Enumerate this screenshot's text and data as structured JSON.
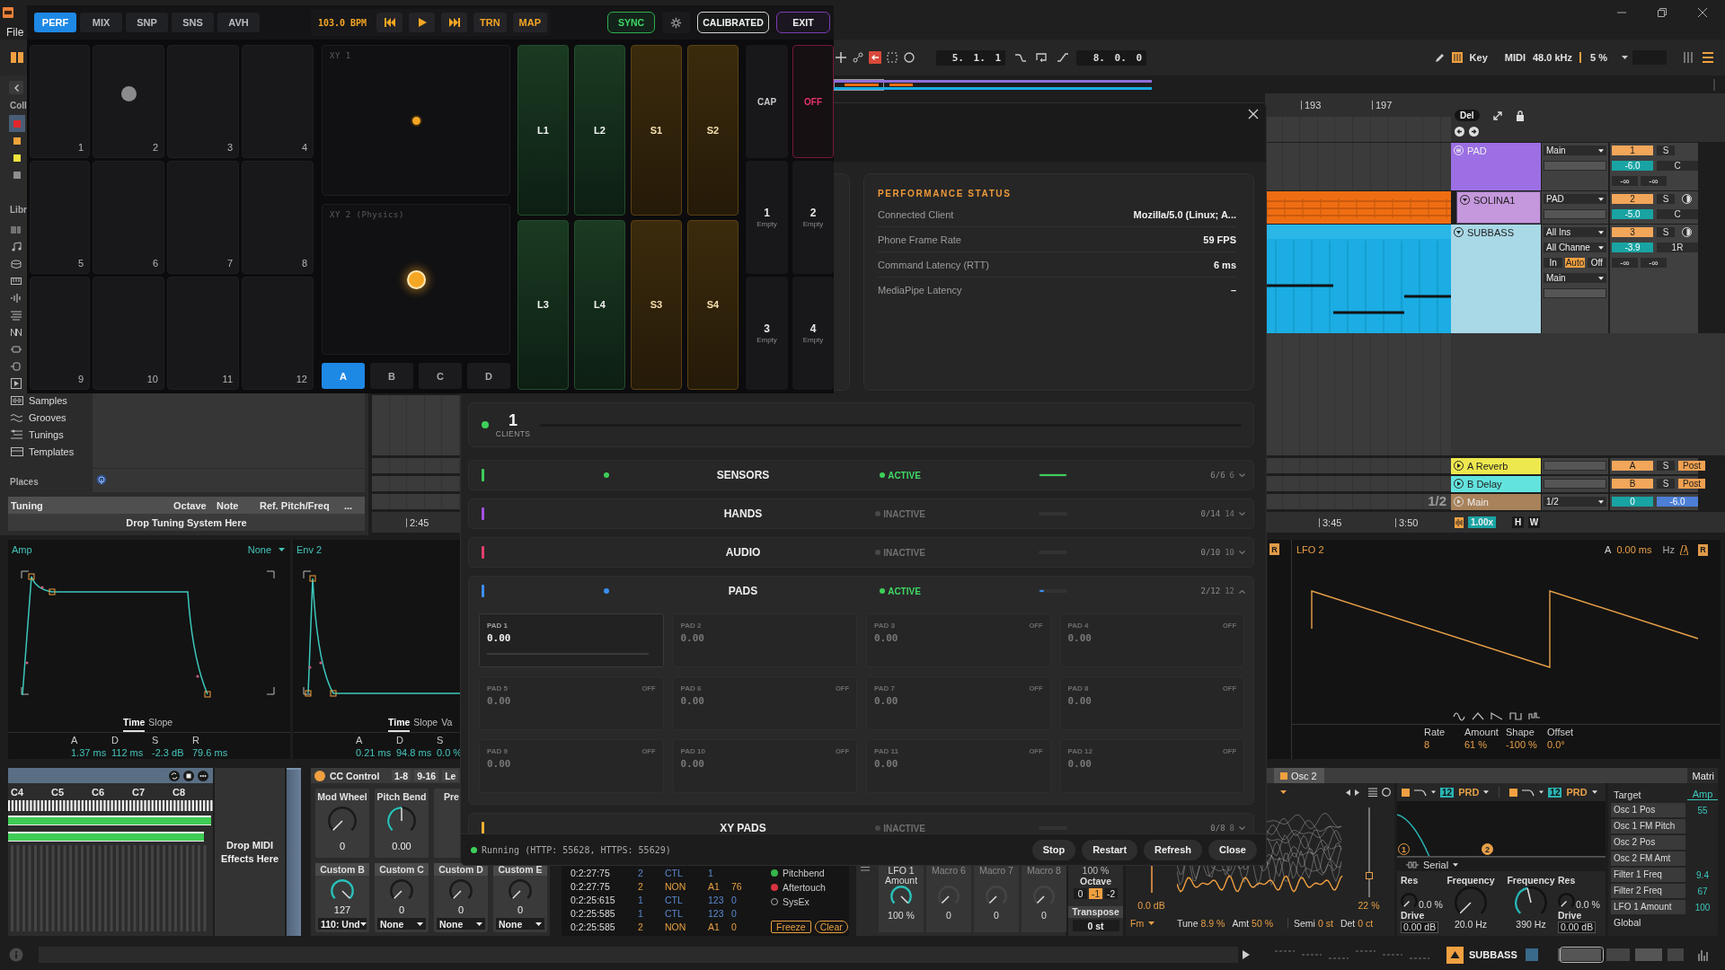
{
  "perf_panel": {
    "tabs": [
      {
        "label": "PERF",
        "selected": true
      },
      {
        "label": "MIX",
        "selected": false
      },
      {
        "label": "SNP",
        "selected": false
      },
      {
        "label": "SNS",
        "selected": false
      },
      {
        "label": "AVH",
        "selected": false
      }
    ],
    "tempo": "103.0 BPM",
    "mode_buttons": [
      "TRN",
      "MAP"
    ],
    "status_buttons": [
      {
        "kind": "sync",
        "label": "SYNC"
      },
      {
        "kind": "settings"
      },
      {
        "kind": "calibrated",
        "label": "CALIBRATED"
      },
      {
        "kind": "exit",
        "label": "EXIT"
      }
    ],
    "pads": [
      {
        "label": "1",
        "pressed": false
      },
      {
        "label": "2",
        "pressed": true
      },
      {
        "label": "3",
        "pressed": false
      },
      {
        "label": "4",
        "pressed": false
      },
      {
        "label": "5",
        "pressed": false
      },
      {
        "label": "6",
        "pressed": false
      },
      {
        "label": "7",
        "pressed": false
      },
      {
        "label": "8",
        "pressed": false
      },
      {
        "label": "9",
        "pressed": false
      },
      {
        "label": "10",
        "pressed": false
      },
      {
        "label": "11",
        "pressed": false
      },
      {
        "label": "12",
        "pressed": false
      }
    ],
    "xy_pads": [
      {
        "title": "XY 1",
        "kind": "plain"
      },
      {
        "title": "XY 2 (Physics)",
        "kind": "physics"
      }
    ],
    "banks": [
      {
        "label": "A",
        "selected": true
      },
      {
        "label": "B",
        "selected": false
      },
      {
        "label": "C",
        "selected": false
      },
      {
        "label": "D",
        "selected": false
      }
    ],
    "loops": [
      {
        "label": "L1",
        "kind": "loop"
      },
      {
        "label": "L2",
        "kind": "loop"
      },
      {
        "label": "S1",
        "kind": "sample"
      },
      {
        "label": "S2",
        "kind": "sample"
      },
      {
        "label": "L3",
        "kind": "loop"
      },
      {
        "label": "L4",
        "kind": "loop"
      },
      {
        "label": "S3",
        "kind": "sample"
      },
      {
        "label": "S4",
        "kind": "sample"
      }
    ],
    "capture": "CAP",
    "power": {
      "label": "OFF",
      "on": false
    },
    "slots": [
      {
        "number": "1",
        "status": "Empty"
      },
      {
        "number": "2",
        "status": "Empty"
      },
      {
        "number": "3",
        "status": "Empty"
      },
      {
        "number": "4",
        "status": "Empty"
      }
    ]
  },
  "dialog": {
    "status_card": {
      "title": "PERFORMANCE STATUS",
      "rows": [
        {
          "label": "Connected Client",
          "value": "Mozilla/5.0 (Linux; A..."
        },
        {
          "label": "Phone Frame Rate",
          "value": "59 FPS"
        },
        {
          "label": "Command Latency (RTT)",
          "value": "6 ms"
        },
        {
          "label": "MediaPipe Latency",
          "value": "–"
        }
      ]
    },
    "clients": {
      "count": "1",
      "label": "CLIENTS",
      "connected": true
    },
    "sections": [
      {
        "name": "SENSORS",
        "color": "#3ecf5a",
        "active": true,
        "status": "ACTIVE",
        "level": 1,
        "count": "6/6",
        "total": "6",
        "expanded": false
      },
      {
        "name": "HANDS",
        "color": "#a44fe2",
        "active": false,
        "status": "INACTIVE",
        "level": 0,
        "count": "0/14",
        "total": "14",
        "expanded": false
      },
      {
        "name": "AUDIO",
        "color": "#e23f6c",
        "active": false,
        "status": "INACTIVE",
        "level": 0,
        "count": "0/10",
        "total": "10",
        "expanded": false
      },
      {
        "name": "PADS",
        "color": "#3b8ef0",
        "active": true,
        "status": "ACTIVE",
        "level": 0.17,
        "count": "2/12",
        "total": "12",
        "expanded": true,
        "pads": [
          {
            "label": "PAD 1",
            "value": "0.00",
            "active": true
          },
          {
            "label": "PAD 2",
            "value": "0.00",
            "active": false
          },
          {
            "label": "PAD 3",
            "value": "0.00",
            "badge": "OFF",
            "active": false
          },
          {
            "label": "PAD 4",
            "value": "0.00",
            "badge": "OFF",
            "active": false
          },
          {
            "label": "PAD 5",
            "value": "0.00",
            "badge": "OFF",
            "active": false
          },
          {
            "label": "PAD 6",
            "value": "0.00",
            "badge": "OFF",
            "active": false
          },
          {
            "label": "PAD 7",
            "value": "0.00",
            "badge": "OFF",
            "active": false
          },
          {
            "label": "PAD 8",
            "value": "0.00",
            "badge": "OFF",
            "active": false
          },
          {
            "label": "PAD 9",
            "value": "0.00",
            "badge": "OFF",
            "active": false
          },
          {
            "label": "PAD 10",
            "value": "0.00",
            "badge": "OFF",
            "active": false
          },
          {
            "label": "PAD 11",
            "value": "0.00",
            "badge": "OFF",
            "active": false
          },
          {
            "label": "PAD 12",
            "value": "0.00",
            "badge": "OFF",
            "active": false
          }
        ]
      },
      {
        "name": "XY PADS",
        "color": "#f0b030",
        "active": false,
        "status": "INACTIVE",
        "level": 0,
        "count": "0/8",
        "total": "8",
        "expanded": false
      }
    ],
    "server_status": "Running (HTTP: 55628, HTTPS: 55629)",
    "running": true,
    "buttons": [
      "Stop",
      "Restart",
      "Refresh",
      "Close"
    ]
  },
  "daw": {
    "menu": [
      "File"
    ],
    "toolbar": {
      "position": "5. 1. 1",
      "loop_length": "8. 0. 0",
      "key": "Key",
      "midi": "MIDI",
      "sample_rate": "48.0 kHz",
      "cpu": "5 %"
    },
    "browser": {
      "collections_heading": "Coll",
      "collections": [
        {
          "color": "#e3262c",
          "selected": true
        },
        {
          "color": "#f0a23a",
          "selected": false
        },
        {
          "color": "#f1e23c",
          "selected": false
        },
        {
          "color": "#8e8e8e",
          "selected": false
        }
      ],
      "library_heading": "Libr",
      "library": [
        {
          "label": "Samples"
        },
        {
          "label": "Grooves"
        },
        {
          "label": "Tunings"
        },
        {
          "label": "Templates"
        }
      ],
      "places_heading": "Places",
      "tuning": {
        "columns": [
          "Tuning",
          "Octave",
          "Note",
          "Ref. Pitch/Freq",
          "..."
        ],
        "drop_hint": "Drop Tuning System Here"
      }
    },
    "arrangement": {
      "ruler": [
        "193",
        "197"
      ],
      "delete": "Del",
      "tracks": [
        {
          "name": "PAD",
          "kind": "group",
          "color": "#9c6fe4",
          "io": [
            {
              "kind": "dropdown",
              "label": "Main"
            },
            {
              "kind": "field"
            }
          ],
          "number": "1",
          "solo": "S",
          "volume": "-6.0",
          "pan": "C",
          "sends": [
            "-∞",
            "-∞"
          ],
          "children": [
            {
              "name": "SOLINA1",
              "kind": "midi",
              "color": "#c597dc",
              "clip": {
                "color": "#ef6d12"
              },
              "io": [
                {
                  "kind": "dropdown",
                  "label": "PAD"
                },
                {
                  "kind": "field"
                }
              ],
              "number": "2",
              "solo": "S",
              "monitor": true,
              "volume": "-5.0",
              "pan": "C"
            }
          ]
        },
        {
          "name": "SUBBASS",
          "kind": "midi",
          "color": "#a9d8e6",
          "clip": {
            "color": "#1bade3"
          },
          "io": [
            {
              "kind": "dropdown",
              "label": "All Ins"
            },
            {
              "kind": "dropdown",
              "label": "All Channe"
            },
            {
              "kind": "monitor",
              "options": [
                {
                  "label": "In",
                  "selected": false
                },
                {
                  "label": "Auto",
                  "selected": true
                },
                {
                  "label": "Off",
                  "selected": false
                }
              ]
            },
            {
              "kind": "dropdown",
              "label": "Main"
            },
            {
              "kind": "field"
            }
          ],
          "number": "3",
          "solo": "S",
          "monitor": true,
          "volume": "-3.9",
          "pan": "1R",
          "sends": [
            "-∞",
            "-∞"
          ]
        }
      ],
      "returns": [
        {
          "name": "A Reverb",
          "kind": "return",
          "color": "#eee84f",
          "io": [
            {
              "kind": "field"
            }
          ],
          "number": "A",
          "solo": "S",
          "tap": "Post"
        },
        {
          "name": "B Delay",
          "kind": "return",
          "color": "#63e3de",
          "io": [
            {
              "kind": "field"
            }
          ],
          "number": "B",
          "solo": "S",
          "tap": "Post"
        },
        {
          "name": "Main",
          "kind": "master",
          "color": "#a8825a",
          "io": [
            {
              "kind": "dropdown",
              "label": "1/2"
            }
          ],
          "cue": "0",
          "volume": "-6.0"
        }
      ],
      "zoom": "1/2",
      "times": [
        "2:45",
        "3:45",
        "3:50"
      ],
      "speed": "1.00x",
      "view_buttons": [
        "H",
        "W"
      ]
    },
    "detail": {
      "envelopes": [
        {
          "title": "Amp",
          "kind": "adsr",
          "source": "None",
          "tabs": [
            {
              "label": "Time",
              "selected": true
            },
            {
              "label": "Slope",
              "selected": false
            }
          ],
          "params": [
            {
              "name": "A",
              "value": "1.37 ms"
            },
            {
              "name": "D",
              "value": "112 ms"
            },
            {
              "name": "S",
              "value": "-2.3 dB"
            },
            {
              "name": "R",
              "value": "79.6 ms"
            }
          ]
        },
        {
          "title": "Env 2",
          "kind": "pluck",
          "tabs": [
            {
              "label": "Time",
              "selected": true
            },
            {
              "label": "Slope",
              "selected": false
            },
            {
              "label": "Va",
              "selected": false
            }
          ],
          "params": [
            {
              "name": "A",
              "value": "0.21 ms"
            },
            {
              "name": "D",
              "value": "94.8 ms"
            },
            {
              "name": "S",
              "value": "0.0 %"
            }
          ]
        }
      ],
      "lfo": {
        "side_toggle": "R",
        "title": "LFO 2",
        "attack_label": "A",
        "attack": "0.00 ms",
        "rate_unit": "Hz",
        "retrigger": "R",
        "params": [
          {
            "name": "Rate",
            "value": "8"
          },
          {
            "name": "Amount",
            "value": "61 %"
          },
          {
            "name": "Shape",
            "value": "-100 %"
          },
          {
            "name": "Offset",
            "value": "0.0°"
          }
        ]
      }
    },
    "devices": {
      "keyboard": {
        "octaves": [
          "C4",
          "C5",
          "C6",
          "C7",
          "C8"
        ]
      },
      "drop_hint": "Drop MIDI Effects Here",
      "cc_control": {
        "title": "CC Control",
        "on": true,
        "pages": [
          "1-8",
          "9-16",
          "Le"
        ],
        "controls": [
          {
            "name": "Mod Wheel",
            "value": "0",
            "level": 0
          },
          {
            "name": "Pitch Bend",
            "value": "0.00",
            "level": 0.5
          },
          {
            "name": "Pre"
          }
        ],
        "customs": [
          {
            "name": "Custom B",
            "value": "127",
            "level": 1,
            "mapping": "110: Und"
          },
          {
            "name": "Custom C",
            "value": "0",
            "level": 0,
            "mapping": "None"
          },
          {
            "name": "Custom D",
            "value": "0",
            "level": 0,
            "mapping": "None"
          },
          {
            "name": "Custom E",
            "value": "0",
            "level": 0,
            "mapping": "None"
          }
        ]
      },
      "midi_monitor": {
        "rows": [
          {
            "kind": "control",
            "time": "0:2:27:75",
            "channel": "2",
            "type": "CTL",
            "data1": "1"
          },
          {
            "kind": "note",
            "time": "0:2:27:75",
            "channel": "2",
            "type": "NON",
            "data1": "A1",
            "data2": "76"
          },
          {
            "kind": "control",
            "time": "0:2:25:615",
            "channel": "1",
            "type": "CTL",
            "data1": "123",
            "data2": "0"
          },
          {
            "kind": "control",
            "time": "0:2:25:585",
            "channel": "1",
            "type": "CTL",
            "data1": "123",
            "data2": "0"
          },
          {
            "kind": "note",
            "time": "0:2:25:585",
            "channel": "2",
            "type": "NON",
            "data1": "A1",
            "data2": "0"
          }
        ],
        "filters": [
          {
            "label": "Pitchbend",
            "color": "#35b54a"
          },
          {
            "label": "Aftertouch",
            "color": "#d7323f"
          },
          {
            "label": "SysEx"
          }
        ],
        "buttons": [
          "Freeze",
          "Clear"
        ]
      },
      "macros": [
        {
          "name": "LFO 1 Amount",
          "value": "100 %",
          "level": 1,
          "mapped": true
        },
        {
          "name": "Macro 6",
          "value": "0",
          "mapped": false
        },
        {
          "name": "Macro 7",
          "value": "0",
          "mapped": false
        },
        {
          "name": "Macro 8",
          "value": "0",
          "mapped": false
        }
      ],
      "transpose": {
        "level_value": "100 %",
        "octave_label": "Octave",
        "octaves": [
          {
            "label": "0",
            "selected": false
          },
          {
            "label": "-1",
            "selected": true
          },
          {
            "label": "-2",
            "selected": false
          }
        ],
        "transpose_label": "Transpose",
        "transpose": "0 st"
      },
      "oscillator": {
        "title": "Osc 2",
        "gain": "0.0 dB",
        "mode": "Fm",
        "position": {
          "value": "22 %",
          "level": 0.22
        },
        "params": [
          {
            "label": "Tune",
            "value": "8.9 %"
          },
          {
            "label": "Amt",
            "value": "50 %"
          },
          {
            "label": "Semi",
            "value": "0 st"
          },
          {
            "label": "Det",
            "value": "0 ct"
          }
        ]
      },
      "filter": {
        "slots": [
          {
            "on": true,
            "slope": "12",
            "type": "PRD"
          },
          {
            "on": true,
            "slope": "12",
            "type": "PRD"
          }
        ],
        "markers": [
          {
            "label": "1",
            "selected": false
          },
          {
            "label": "2",
            "selected": true
          }
        ],
        "routing": "Serial",
        "bands": [
          {
            "controls": [
              {
                "kind": "small",
                "name": "Res",
                "value": "0.0 %",
                "level": 0
              },
              {
                "kind": "large",
                "name": "Frequency",
                "value": "20.0 Hz"
              }
            ],
            "drive_label": "Drive",
            "drive": "0.00 dB"
          },
          {
            "controls": [
              {
                "kind": "large",
                "name": "Frequency",
                "value": "390 Hz",
                "level": 0.45
              },
              {
                "kind": "small",
                "name": "Res",
                "value": "0.0 %",
                "level": 0
              }
            ],
            "drive_label": "Drive",
            "drive": "0.00 dB"
          }
        ]
      },
      "matrix": {
        "title": "Matri",
        "target_label": "Target",
        "column": "Amp",
        "rows": [
          {
            "name": "Osc 1 Pos",
            "value": "55"
          },
          {
            "name": "Osc 1 FM Pitch"
          },
          {
            "name": "Osc 2 Pos"
          },
          {
            "name": "Osc 2 FM Amt"
          },
          {
            "name": "Filter 1 Freq",
            "value": "9.4"
          },
          {
            "name": "Filter 2 Freq",
            "value": "67"
          },
          {
            "name": "LFO 1 Amount",
            "value": "100"
          }
        ],
        "footer": "Global"
      }
    },
    "status_bar": {
      "track": "SUBBASS"
    }
  }
}
